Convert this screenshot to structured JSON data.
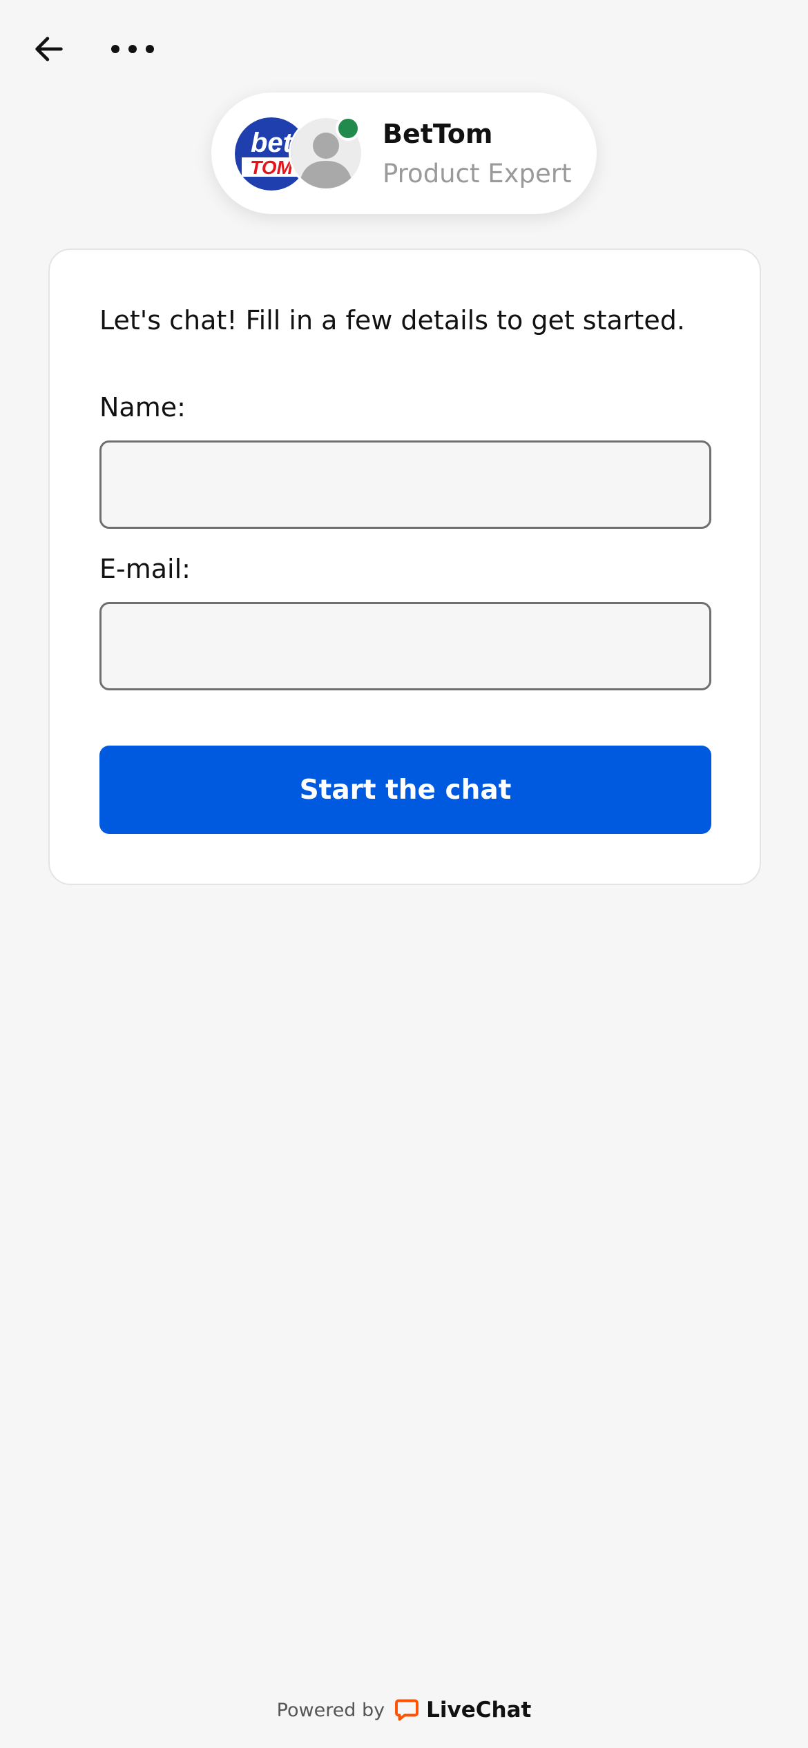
{
  "header": {
    "back_icon": "arrow-left-icon",
    "more_icon": "more-horizontal-icon"
  },
  "agent": {
    "brand_logo_text_top": "bet",
    "brand_logo_text_bottom": "TOM",
    "name": "BetTom",
    "role": "Product Expert",
    "status": "online",
    "status_color": "#218a4c"
  },
  "form": {
    "intro": "Let's chat! Fill in a few details to get started.",
    "name_label": "Name:",
    "name_value": "",
    "email_label": "E-mail:",
    "email_value": "",
    "submit_label": "Start the chat"
  },
  "footer": {
    "powered_by": "Powered by",
    "brand": "LiveChat",
    "brand_icon": "livechat-logo-icon",
    "brand_color": "#ff5100"
  },
  "colors": {
    "accent": "#005ae0",
    "background": "#f6f6f6"
  }
}
